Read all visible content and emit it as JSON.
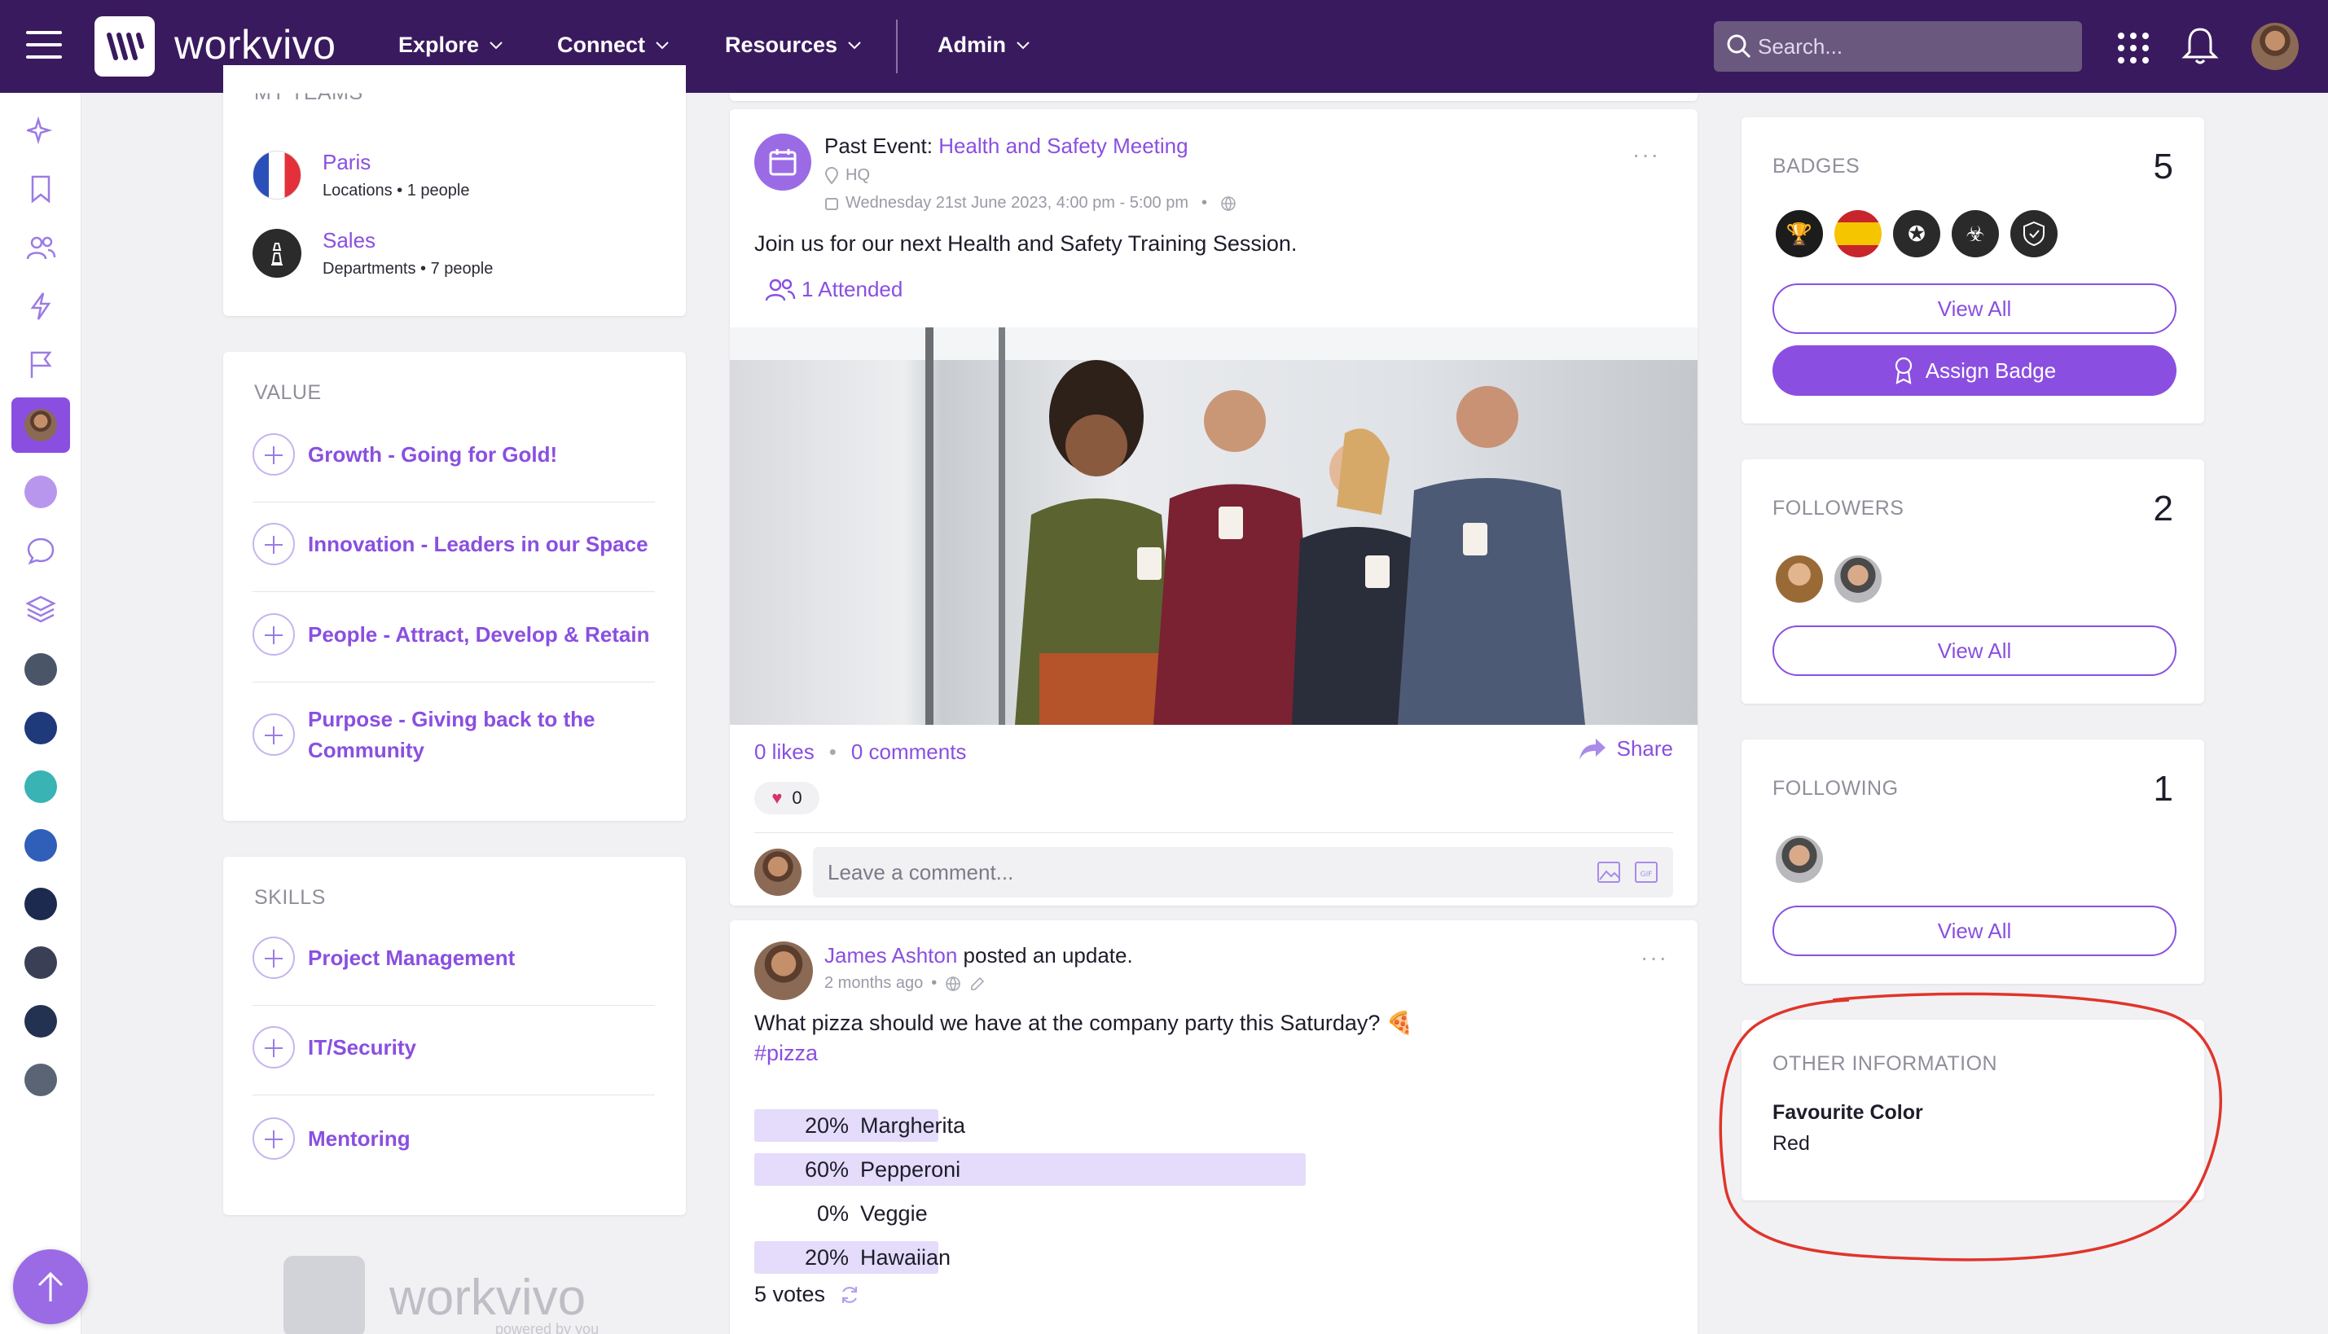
{
  "topbar": {
    "brand": "workvivo",
    "nav": [
      {
        "label": "Explore"
      },
      {
        "label": "Connect"
      },
      {
        "label": "Resources"
      },
      {
        "label": "Admin"
      }
    ],
    "search_placeholder": "Search..."
  },
  "left_column": {
    "teams_title": "MY TEAMS",
    "teams": [
      {
        "name": "Paris",
        "meta": "Locations • 1 people"
      },
      {
        "name": "Sales",
        "meta": "Departments • 7 people"
      }
    ],
    "value_title": "VALUE",
    "values": [
      {
        "label": "Growth - Going for Gold!"
      },
      {
        "label": "Innovation - Leaders in our Space"
      },
      {
        "label": "People - Attract, Develop & Retain"
      },
      {
        "label": "Purpose - Giving back to the Community"
      }
    ],
    "skills_title": "SKILLS",
    "skills": [
      {
        "label": "Project Management"
      },
      {
        "label": "IT/Security"
      },
      {
        "label": "Mentoring"
      }
    ],
    "footer_brand": "workvivo",
    "footer_tagline": "powered by you"
  },
  "event_post": {
    "prefix": "Past Event: ",
    "title": "Health and Safety Meeting",
    "location": "HQ",
    "datetime": "Wednesday 21st June 2023, 4:00 pm - 5:00 pm",
    "dot": "•",
    "body": "Join us for our next Health and Safety Training Session.",
    "attended": "1 Attended",
    "likes": "0 likes",
    "comments": "0 comments",
    "share": "Share",
    "reaction_count": "0",
    "comment_placeholder": "Leave a comment..."
  },
  "poll_post": {
    "author": "James Ashton",
    "action": " posted an update.",
    "time": "2 months ago",
    "dot": "•",
    "question": "What pizza should we have at the company party this Saturday? 🍕",
    "hashtag": "#pizza",
    "options": [
      {
        "pct": "20%",
        "label": "Margherita",
        "value": 0.2
      },
      {
        "pct": "60%",
        "label": "Pepperoni",
        "value": 0.6
      },
      {
        "pct": "0%",
        "label": "Veggie",
        "value": 0.0
      },
      {
        "pct": "20%",
        "label": "Hawaiian",
        "value": 0.2
      }
    ],
    "votes": "5 votes"
  },
  "right_column": {
    "badges": {
      "title": "BADGES",
      "count": "5",
      "view_all": "View All",
      "assign": "Assign Badge"
    },
    "followers": {
      "title": "FOLLOWERS",
      "count": "2",
      "view_all": "View All"
    },
    "following": {
      "title": "FOLLOWING",
      "count": "1",
      "view_all": "View All"
    },
    "other": {
      "title": "OTHER INFORMATION",
      "field_label": "Favourite Color",
      "field_value": "Red"
    }
  },
  "colors": {
    "topbar": "#3a1a5e",
    "accent": "#8a4fe0",
    "annotation": "#e0352b"
  }
}
